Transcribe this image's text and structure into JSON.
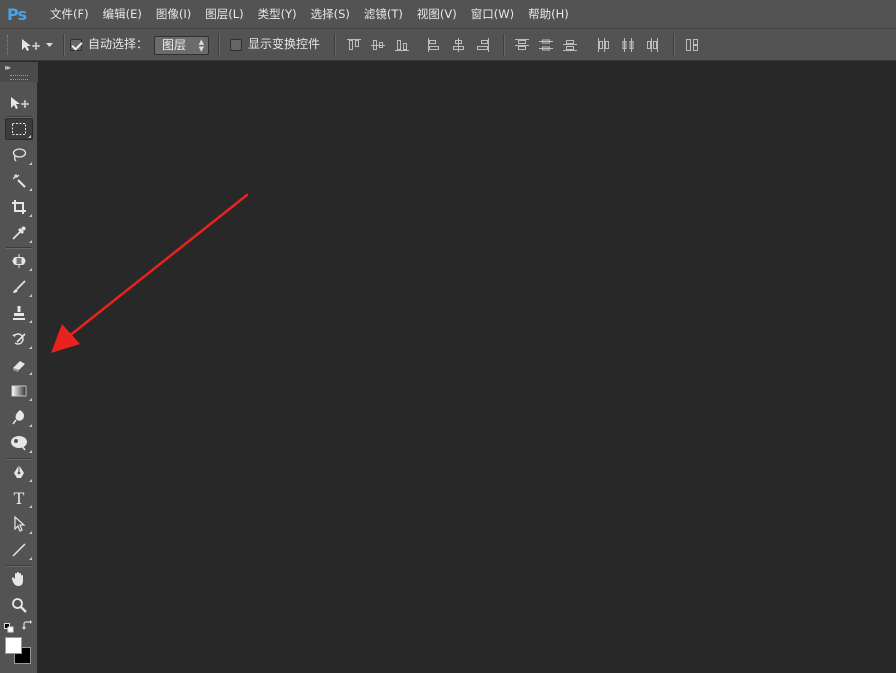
{
  "app": {
    "logo": "Ps"
  },
  "menu": [
    {
      "label": "文件(F)"
    },
    {
      "label": "编辑(E)"
    },
    {
      "label": "图像(I)"
    },
    {
      "label": "图层(L)"
    },
    {
      "label": "类型(Y)"
    },
    {
      "label": "选择(S)"
    },
    {
      "label": "滤镜(T)"
    },
    {
      "label": "视图(V)"
    },
    {
      "label": "窗口(W)"
    },
    {
      "label": "帮助(H)"
    }
  ],
  "options_bar": {
    "tool_preset_icon": "move-tool-icon",
    "auto_select": {
      "label": "自动选择：",
      "checked": true
    },
    "auto_select_target": {
      "value": "图层"
    },
    "show_transform_controls": {
      "label": "显示变换控件",
      "checked": false
    },
    "align_icons": [
      "align-top-edges-icon",
      "align-vertical-centers-icon",
      "align-bottom-edges-icon",
      "align-left-edges-icon",
      "align-horizontal-centers-icon",
      "align-right-edges-icon"
    ],
    "distribute_icons": [
      "distribute-top-edges-icon",
      "distribute-vertical-centers-icon",
      "distribute-bottom-edges-icon",
      "distribute-left-edges-icon",
      "distribute-horizontal-centers-icon",
      "distribute-right-edges-icon"
    ],
    "auto_align_icon": "auto-align-layers-icon"
  },
  "toolbar": {
    "tools": [
      "move-tool",
      "rectangular-marquee-tool",
      "lasso-tool",
      "magic-wand-tool",
      "crop-tool",
      "eyedropper-tool",
      "spot-healing-brush-tool",
      "brush-tool",
      "clone-stamp-tool",
      "history-brush-tool",
      "eraser-tool",
      "gradient-tool",
      "blur-tool",
      "dodge-tool",
      "pen-tool",
      "type-tool",
      "path-selection-tool",
      "line-tool",
      "hand-tool",
      "zoom-tool"
    ],
    "type_tool_glyph": "T",
    "foreground_color": "#ffffff",
    "background_color": "#000000"
  },
  "colors": {
    "chrome": "#535353",
    "workspace": "#282828",
    "logo": "#4aa3e6",
    "annotation_arrow": "#e8231e"
  }
}
